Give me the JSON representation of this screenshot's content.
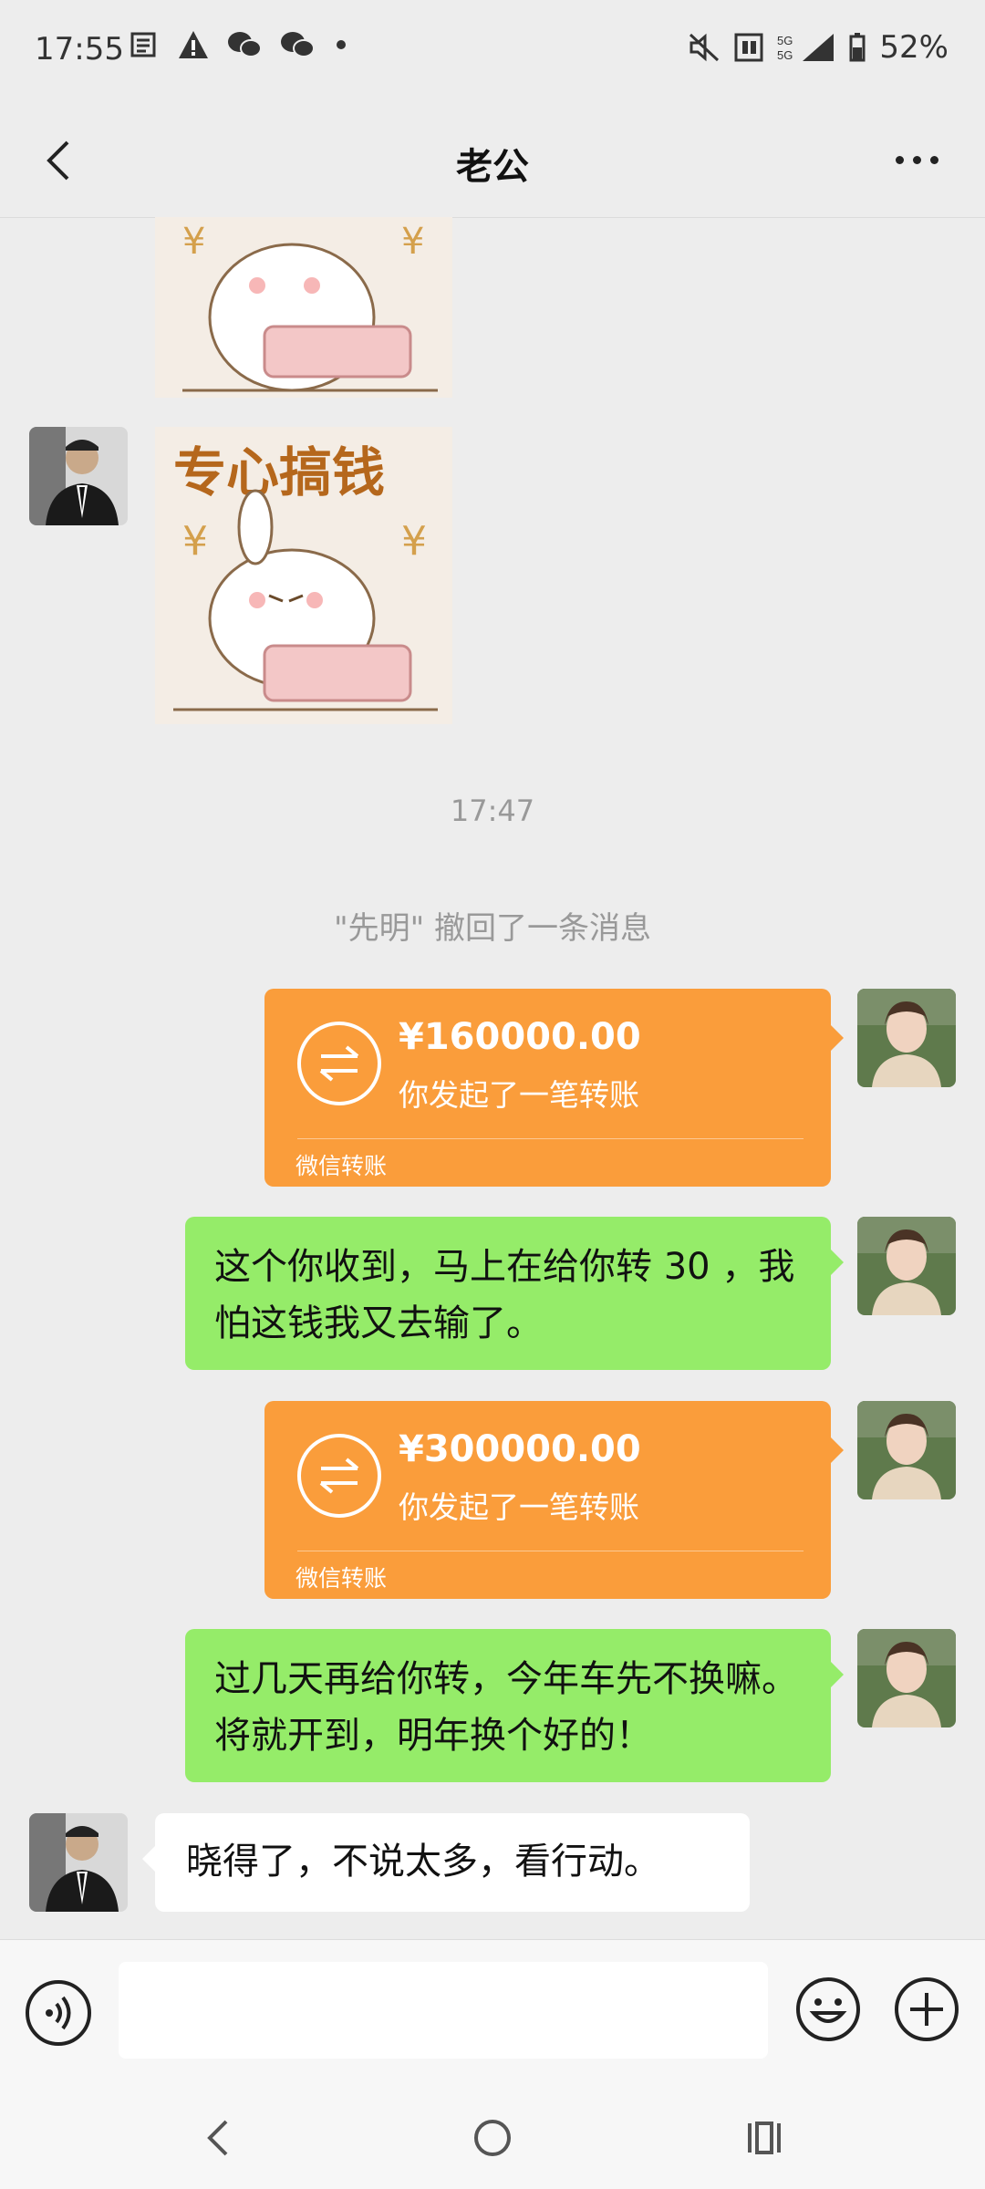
{
  "status_bar": {
    "time": "17:55",
    "battery": "52%"
  },
  "header": {
    "title": "老公"
  },
  "messages": {
    "timestamp": "17:47",
    "recall_notice": "\"先明\" 撤回了一条消息",
    "transfer1": {
      "amount": "¥160000.00",
      "desc": "你发起了一笔转账",
      "label": "微信转账"
    },
    "text1": "这个你收到，马上在给你转 30 ，我怕这钱我又去输了。",
    "transfer2": {
      "amount": "¥300000.00",
      "desc": "你发起了一笔转账",
      "label": "微信转账"
    },
    "text2": "过几天再给你转，今年车先不换嘛。将就开到，明年换个好的！",
    "text3": "晓得了，不说太多，看行动。"
  },
  "sticker": {
    "caption": "专心搞钱"
  },
  "input_bar": {
    "placeholder": ""
  }
}
